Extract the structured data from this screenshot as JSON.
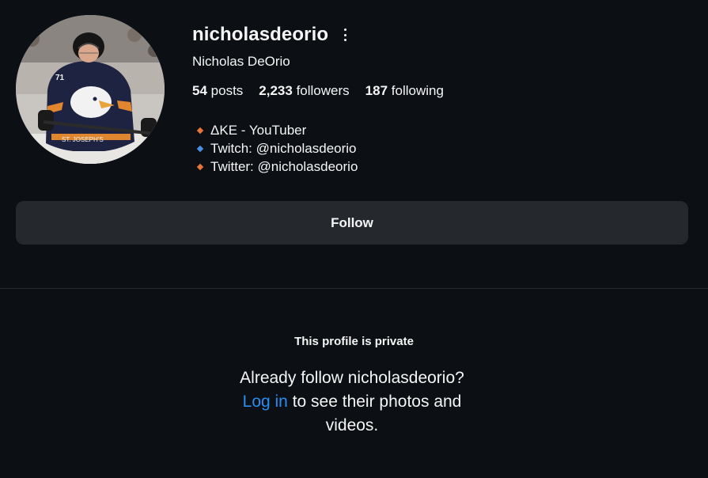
{
  "profile": {
    "username": "nicholasdeorio",
    "full_name": "Nicholas DeOrio",
    "more_icon": "more-vertical-icon",
    "avatar_alt": "hockey player profile photo"
  },
  "stats": {
    "posts_count": "54",
    "posts_label": "posts",
    "followers_count": "2,233",
    "followers_label": "followers",
    "following_count": "187",
    "following_label": "following"
  },
  "bio": [
    {
      "text": "ΔKE - YouTuber",
      "bullet_color": "#e8743b"
    },
    {
      "text": "Twitch: @nicholasdeorio",
      "bullet_color": "#4a8fe3"
    },
    {
      "text": "Twitter: @nicholasdeorio",
      "bullet_color": "#e8743b"
    }
  ],
  "actions": {
    "follow_label": "Follow"
  },
  "private": {
    "title": "This profile is private",
    "message_part1": "Already follow nicholasdeorio?",
    "login_label": "Log in",
    "message_part2": "to see their photos and videos."
  },
  "colors": {
    "background": "#0c1014",
    "button": "#25292e",
    "link": "#2a8df2"
  }
}
